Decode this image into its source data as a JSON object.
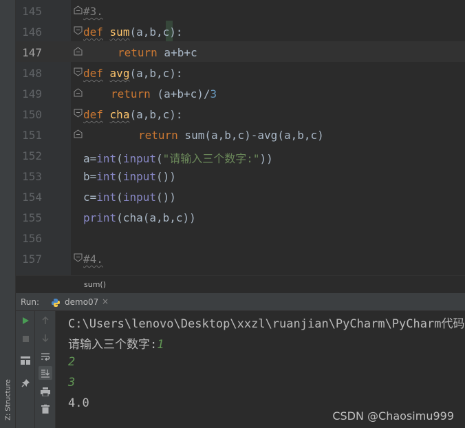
{
  "editor": {
    "lines": [
      {
        "num": "145",
        "fold": "end",
        "indent": 0,
        "tokens": [
          [
            "cm sq-grey",
            "#3."
          ]
        ]
      },
      {
        "num": "146",
        "fold": "start",
        "indent": 0,
        "tokens": [
          [
            "kw sq-grey",
            "def"
          ],
          [
            "",
            " "
          ],
          [
            "fn sq-grey",
            "sum"
          ],
          [
            "",
            "(a"
          ],
          [
            "",
            ","
          ],
          [
            "",
            "b"
          ],
          [
            "",
            ","
          ],
          [
            "",
            "c):"
          ]
        ]
      },
      {
        "num": "147",
        "fold": "end",
        "indent": 50,
        "current": true,
        "tokens": [
          [
            "kw",
            "return"
          ],
          [
            "",
            " a+b+c"
          ]
        ]
      },
      {
        "num": "148",
        "fold": "start",
        "indent": 0,
        "tokens": [
          [
            "kw sq-grey",
            "def"
          ],
          [
            "",
            " "
          ],
          [
            "fn sq-grey",
            "avg"
          ],
          [
            "",
            "(a"
          ],
          [
            "",
            ","
          ],
          [
            "",
            "b"
          ],
          [
            "",
            ","
          ],
          [
            "",
            "c):"
          ]
        ]
      },
      {
        "num": "149",
        "fold": "end",
        "indent": 40,
        "tokens": [
          [
            "kw",
            "return"
          ],
          [
            "",
            " (a+b+c)/"
          ],
          [
            "num",
            "3"
          ]
        ]
      },
      {
        "num": "150",
        "fold": "start",
        "indent": 0,
        "tokens": [
          [
            "kw sq-grey",
            "def"
          ],
          [
            "",
            " "
          ],
          [
            "fn sq-grey",
            "cha"
          ],
          [
            "",
            "(a"
          ],
          [
            "",
            ","
          ],
          [
            "",
            "b"
          ],
          [
            "",
            ","
          ],
          [
            "",
            "c):"
          ]
        ]
      },
      {
        "num": "151",
        "fold": "end",
        "indent": 80,
        "tokens": [
          [
            "kw",
            "return"
          ],
          [
            "",
            " sum(a"
          ],
          [
            "",
            ","
          ],
          [
            "",
            "b"
          ],
          [
            "",
            ","
          ],
          [
            "",
            "c)-avg(a"
          ],
          [
            "",
            ","
          ],
          [
            "",
            "b"
          ],
          [
            "",
            ","
          ],
          [
            "",
            "c)"
          ]
        ]
      },
      {
        "num": "152",
        "fold": "",
        "indent": 0,
        "tokens": [
          [
            "",
            "a="
          ],
          [
            "bi",
            "int"
          ],
          [
            "",
            "("
          ],
          [
            "bi",
            "input"
          ],
          [
            "",
            "("
          ],
          [
            "str",
            "\"请输入三个数字:\""
          ],
          [
            "",
            "))"
          ]
        ]
      },
      {
        "num": "153",
        "fold": "",
        "indent": 0,
        "tokens": [
          [
            "",
            "b="
          ],
          [
            "bi",
            "int"
          ],
          [
            "",
            "("
          ],
          [
            "bi",
            "input"
          ],
          [
            "",
            "())"
          ]
        ]
      },
      {
        "num": "154",
        "fold": "",
        "indent": 0,
        "tokens": [
          [
            "",
            "c="
          ],
          [
            "bi",
            "int"
          ],
          [
            "",
            "("
          ],
          [
            "bi",
            "input"
          ],
          [
            "",
            "())"
          ]
        ]
      },
      {
        "num": "155",
        "fold": "",
        "indent": 0,
        "tokens": [
          [
            "bi",
            "print"
          ],
          [
            "",
            "(cha(a"
          ],
          [
            "",
            ","
          ],
          [
            "",
            "b"
          ],
          [
            "",
            ","
          ],
          [
            "",
            "c))"
          ]
        ]
      },
      {
        "num": "156",
        "fold": "",
        "indent": 0,
        "tokens": []
      },
      {
        "num": "157",
        "fold": "start",
        "indent": 0,
        "tokens": [
          [
            "cm sq-grey",
            "#4."
          ]
        ]
      }
    ]
  },
  "breadcrumb": {
    "label": "sum()"
  },
  "run": {
    "label": "Run:",
    "tab_label": "demo07",
    "tab_close": "×",
    "console_lines": [
      {
        "text": "C:\\Users\\lenovo\\Desktop\\xxzl\\ruanjian\\PyCharm\\PyCharm代码\\",
        "type": "output"
      },
      {
        "text": "请输入三个数字:",
        "type": "output",
        "input": "1"
      },
      {
        "text": "2",
        "type": "input"
      },
      {
        "text": "3",
        "type": "input"
      },
      {
        "text": "4.0",
        "type": "output"
      }
    ]
  },
  "sidebar": {
    "structure_label": "Z: Structure"
  },
  "watermark": "CSDN @Chaosimu999",
  "colors": {
    "accent_run": "#499c54",
    "keyword": "#cc7832",
    "function": "#ffc66d",
    "builtin": "#8888c6",
    "string": "#6a8759",
    "number": "#6897bb",
    "input_text": "#629755"
  },
  "icons": {
    "run_bar_1": [
      "run-icon",
      "stop-icon",
      "layout-icon",
      "pin-icon"
    ],
    "run_bar_2": [
      "up-arrow-icon",
      "down-arrow-icon",
      "soft-wrap-icon",
      "scroll-to-end-icon",
      "print-icon",
      "trash-icon"
    ]
  }
}
